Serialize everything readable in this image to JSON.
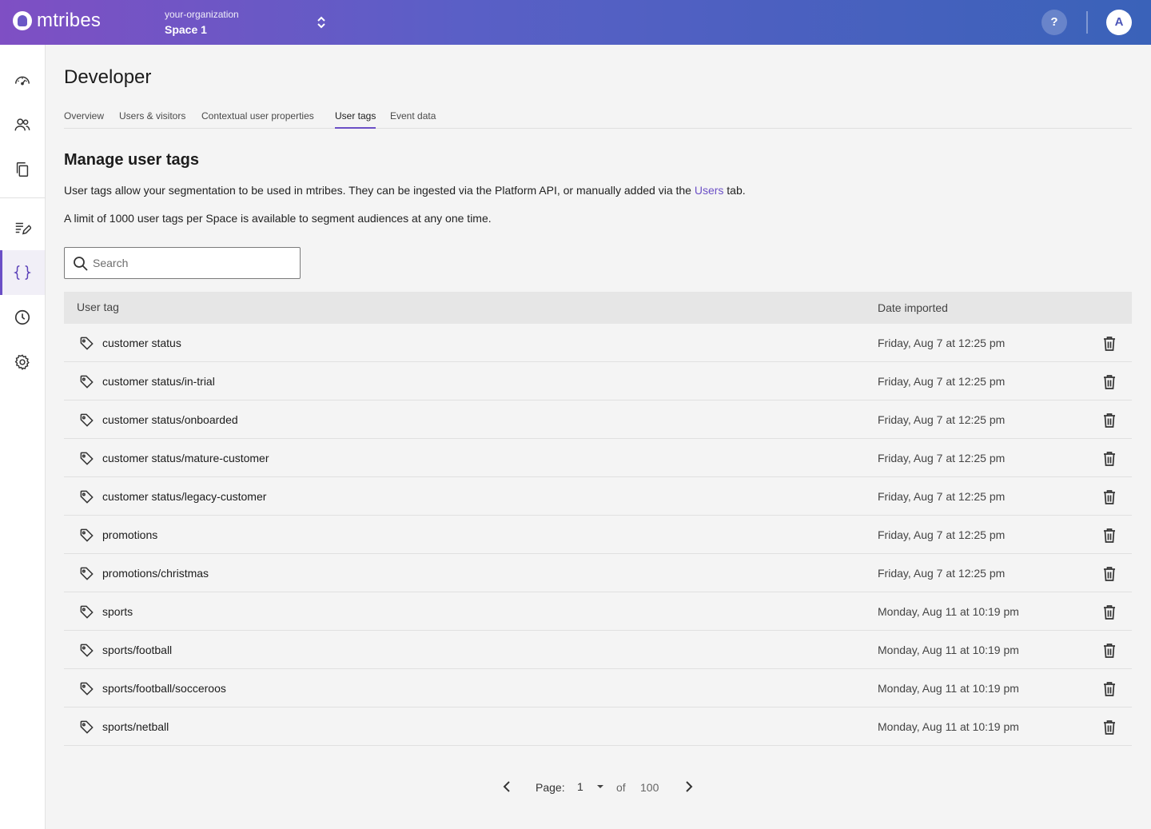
{
  "header": {
    "logo_text": "mtribes",
    "org_name": "your-organization",
    "space_name": "Space 1",
    "help_label": "?",
    "avatar_initial": "A"
  },
  "sidebar": {
    "items": [
      {
        "icon": "dashboard-gauge-icon"
      },
      {
        "icon": "people-icon"
      },
      {
        "icon": "copy-icon"
      },
      {
        "icon": "edit-notes-icon"
      },
      {
        "icon": "code-braces-icon",
        "active": true
      },
      {
        "icon": "clock-icon"
      },
      {
        "icon": "gear-icon"
      }
    ]
  },
  "page": {
    "title": "Developer",
    "tabs": [
      "Overview",
      "Users & visitors",
      "Contextual user properties",
      "User tags",
      "Event data"
    ],
    "active_tab": "User tags",
    "section_title": "Manage user tags",
    "desc1_before": "User tags allow your segmentation to be used in mtribes. They can be ingested via the Platform API, or manually added via the ",
    "desc1_link": "Users",
    "desc1_after": " tab.",
    "desc2": "A limit of 1000 user tags per Space is available to segment audiences at any one time.",
    "search_placeholder": "Search"
  },
  "table": {
    "columns": [
      "User tag",
      "Date imported"
    ],
    "rows": [
      {
        "tag": "customer status",
        "date": "Friday, Aug 7 at 12:25 pm"
      },
      {
        "tag": "customer status/in-trial",
        "date": "Friday, Aug 7 at 12:25 pm"
      },
      {
        "tag": "customer status/onboarded",
        "date": "Friday, Aug 7 at 12:25 pm"
      },
      {
        "tag": "customer status/mature-customer",
        "date": "Friday, Aug 7 at 12:25 pm"
      },
      {
        "tag": "customer status/legacy-customer",
        "date": "Friday, Aug 7 at 12:25 pm"
      },
      {
        "tag": "promotions",
        "date": "Friday, Aug 7 at 12:25 pm"
      },
      {
        "tag": "promotions/christmas",
        "date": "Friday, Aug 7 at 12:25 pm"
      },
      {
        "tag": "sports",
        "date": "Monday, Aug 11 at 10:19 pm"
      },
      {
        "tag": "sports/football",
        "date": "Monday, Aug 11 at 10:19 pm"
      },
      {
        "tag": "sports/football/socceroos",
        "date": "Monday, Aug 11 at 10:19 pm"
      },
      {
        "tag": "sports/netball",
        "date": "Monday, Aug 11 at 10:19 pm"
      }
    ]
  },
  "pagination": {
    "label": "Page:",
    "current": "1",
    "of_label": "of",
    "total": "100"
  },
  "colors": {
    "accent": "#6b4fc6",
    "header_gradient_start": "#7f4fc4",
    "header_gradient_end": "#3a62b9"
  }
}
